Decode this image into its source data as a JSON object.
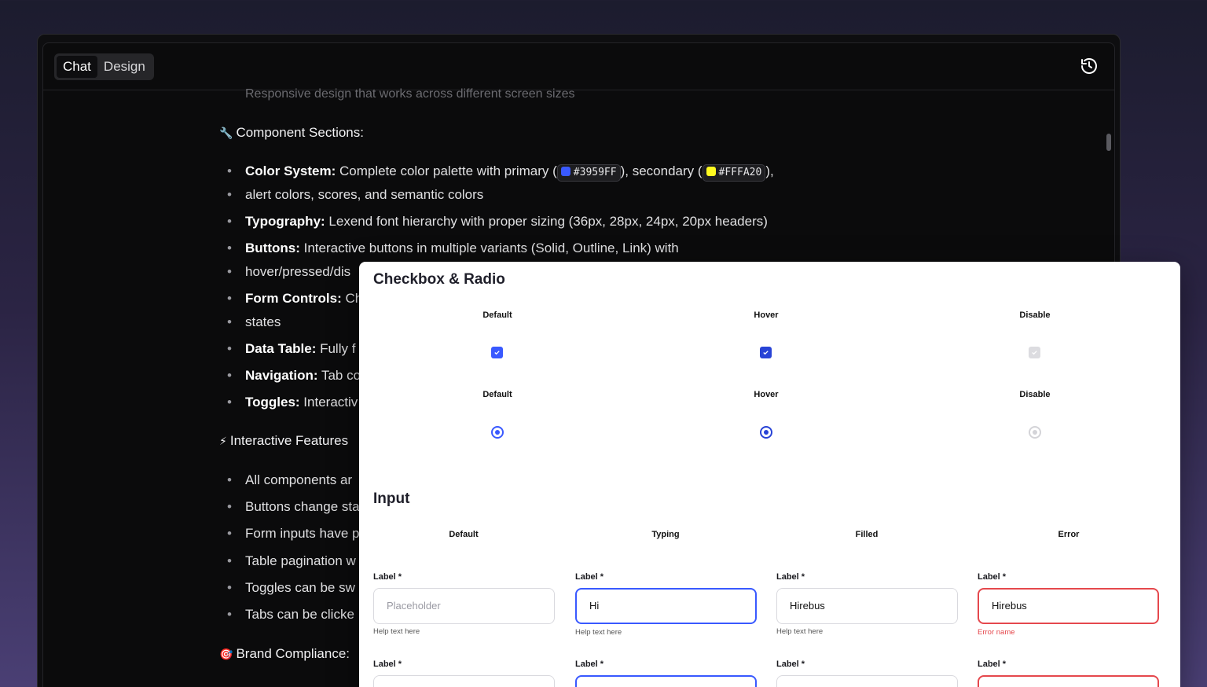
{
  "tabs": [
    {
      "label": "Chat",
      "active": true
    },
    {
      "label": "Design",
      "active": false
    }
  ],
  "chat": {
    "faded_line": "Responsive design that works across different screen sizes",
    "section_component": {
      "emoji": "🔧",
      "title": "Component Sections:"
    },
    "bullets": [
      {
        "bold": "Color System:",
        "text_a": " Complete color palette with primary (",
        "chip1": "#3959FF",
        "text_b": "), secondary (",
        "chip2": "#FFFA20",
        "text_c": "),"
      },
      {
        "line2": "alert colors, scores, and semantic colors"
      },
      {
        "bold": "Typography:",
        "text": " Lexend font hierarchy with proper sizing (36px, 28px, 24px, 20px headers)"
      },
      {
        "bold": "Buttons:",
        "text": " Interactive buttons in multiple variants (Solid, Outline, Link) with"
      },
      {
        "line2": "hover/pressed/dis"
      },
      {
        "bold": "Form Controls:",
        "text": " Ch"
      },
      {
        "line2": "states"
      },
      {
        "bold": "Data Table:",
        "text": " Fully f"
      },
      {
        "bold": "Navigation:",
        "text": " Tab co"
      },
      {
        "bold": "Toggles:",
        "text": " Interactiv"
      }
    ],
    "section_interactive": {
      "emoji": "⚡",
      "title": "Interactive Features"
    },
    "interactive_bullets": [
      "All components ar",
      "Buttons change sta",
      "Form inputs have p",
      "Table pagination w",
      "Toggles can be sw",
      "Tabs can be clicke"
    ],
    "section_brand": {
      "emoji": "🎯",
      "title": "Brand Compliance:"
    }
  },
  "colors": {
    "primary": "#3959FF",
    "secondary": "#FFFA20",
    "error": "#E5484D"
  },
  "panel": {
    "checkbox_title": "Checkbox & Radio",
    "checkbox_states": [
      "Default",
      "Hover",
      "Disable"
    ],
    "radio_states": [
      "Default",
      "Hover",
      "Disable"
    ],
    "input_title": "Input",
    "input_states": [
      "Default",
      "Typing",
      "Filled",
      "Error"
    ],
    "inputs": [
      {
        "label": "Label *",
        "value": "",
        "placeholder": "Placeholder",
        "help": "Help text here"
      },
      {
        "label": "Label *",
        "value": "Hi",
        "help": "Help text here"
      },
      {
        "label": "Label *",
        "value": "Hirebus",
        "help": "Help text here"
      },
      {
        "label": "Label *",
        "value": "Hirebus",
        "help": "Error name"
      }
    ],
    "inputs_row2_labels": [
      "Label *",
      "Label *",
      "Label *",
      "Label *"
    ]
  }
}
